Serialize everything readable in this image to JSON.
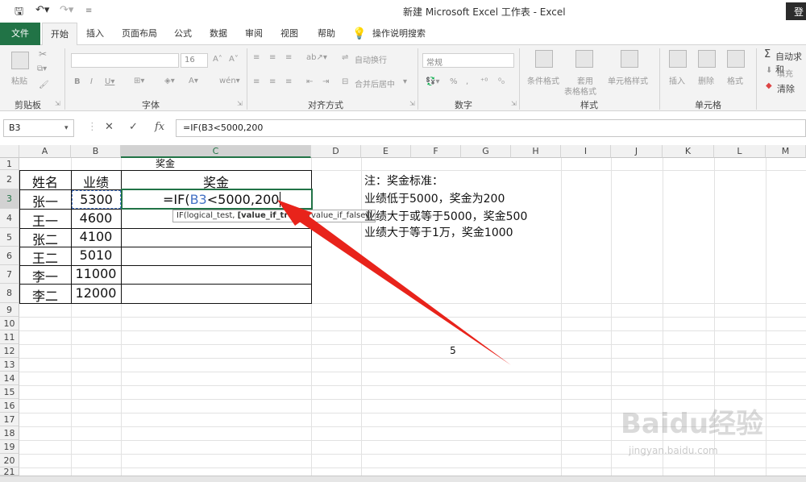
{
  "window": {
    "title": "新建 Microsoft Excel 工作表  -  Excel",
    "login": "登"
  },
  "tabs": [
    "文件",
    "开始",
    "插入",
    "页面布局",
    "公式",
    "数据",
    "审阅",
    "视图",
    "帮助",
    "操作说明搜索"
  ],
  "ribbon": {
    "clipboard": {
      "label": "剪贴板",
      "paste": "粘贴"
    },
    "font": {
      "label": "字体",
      "size": "16"
    },
    "alignment": {
      "label": "对齐方式",
      "wrap": "自动换行",
      "merge": "合并后居中"
    },
    "number": {
      "label": "数字",
      "format": "常规"
    },
    "styles": {
      "label": "样式",
      "conditional": "条件格式",
      "table": "套用",
      "table2": "表格格式",
      "cell_style": "单元格样式"
    },
    "cells": {
      "label": "单元格",
      "insert": "插入",
      "delete": "删除",
      "format": "格式"
    },
    "editing": {
      "autosum": "自动求和",
      "fill": "填充",
      "clear": "清除"
    }
  },
  "formula_bar": {
    "name_box": "B3",
    "formula": "=IF(B3<5000,200"
  },
  "columns": [
    "A",
    "B",
    "C",
    "D",
    "E",
    "F",
    "G",
    "H",
    "I",
    "J",
    "K",
    "L",
    "M"
  ],
  "rows": [
    "1",
    "2",
    "3",
    "4",
    "5",
    "6",
    "7",
    "8",
    "9",
    "10",
    "11",
    "12",
    "13",
    "14",
    "15",
    "16",
    "17",
    "18",
    "19",
    "20",
    "21"
  ],
  "sheet": {
    "c1": "奖金",
    "header": [
      "姓名",
      "业绩",
      "奖金"
    ],
    "data": [
      [
        "张一",
        "5300"
      ],
      [
        "王一",
        "4600"
      ],
      [
        "张二",
        "4100"
      ],
      [
        "王二",
        "5010"
      ],
      [
        "李一",
        "11000"
      ],
      [
        "李二",
        "12000"
      ]
    ],
    "editing_prefix": "=IF(",
    "editing_ref": "B3",
    "editing_suffix": "<5000,200",
    "f12": "5",
    "notes": [
      "注：奖金标准：",
      "业绩低于5000，奖金为200",
      "业绩大于或等于5000，奖金500",
      "业绩大于等于1万，奖金1000"
    ]
  },
  "tooltip": {
    "part1": "IF(logical_test, ",
    "part2": "[value_if_true]",
    "part3": ", [value_if_false])"
  },
  "watermark": {
    "text": "Baidu经验",
    "url": "jingyan.baidu.com"
  },
  "colors": {
    "accent": "#217346",
    "arrow": "#e8231b",
    "ref": "#4472c4"
  }
}
